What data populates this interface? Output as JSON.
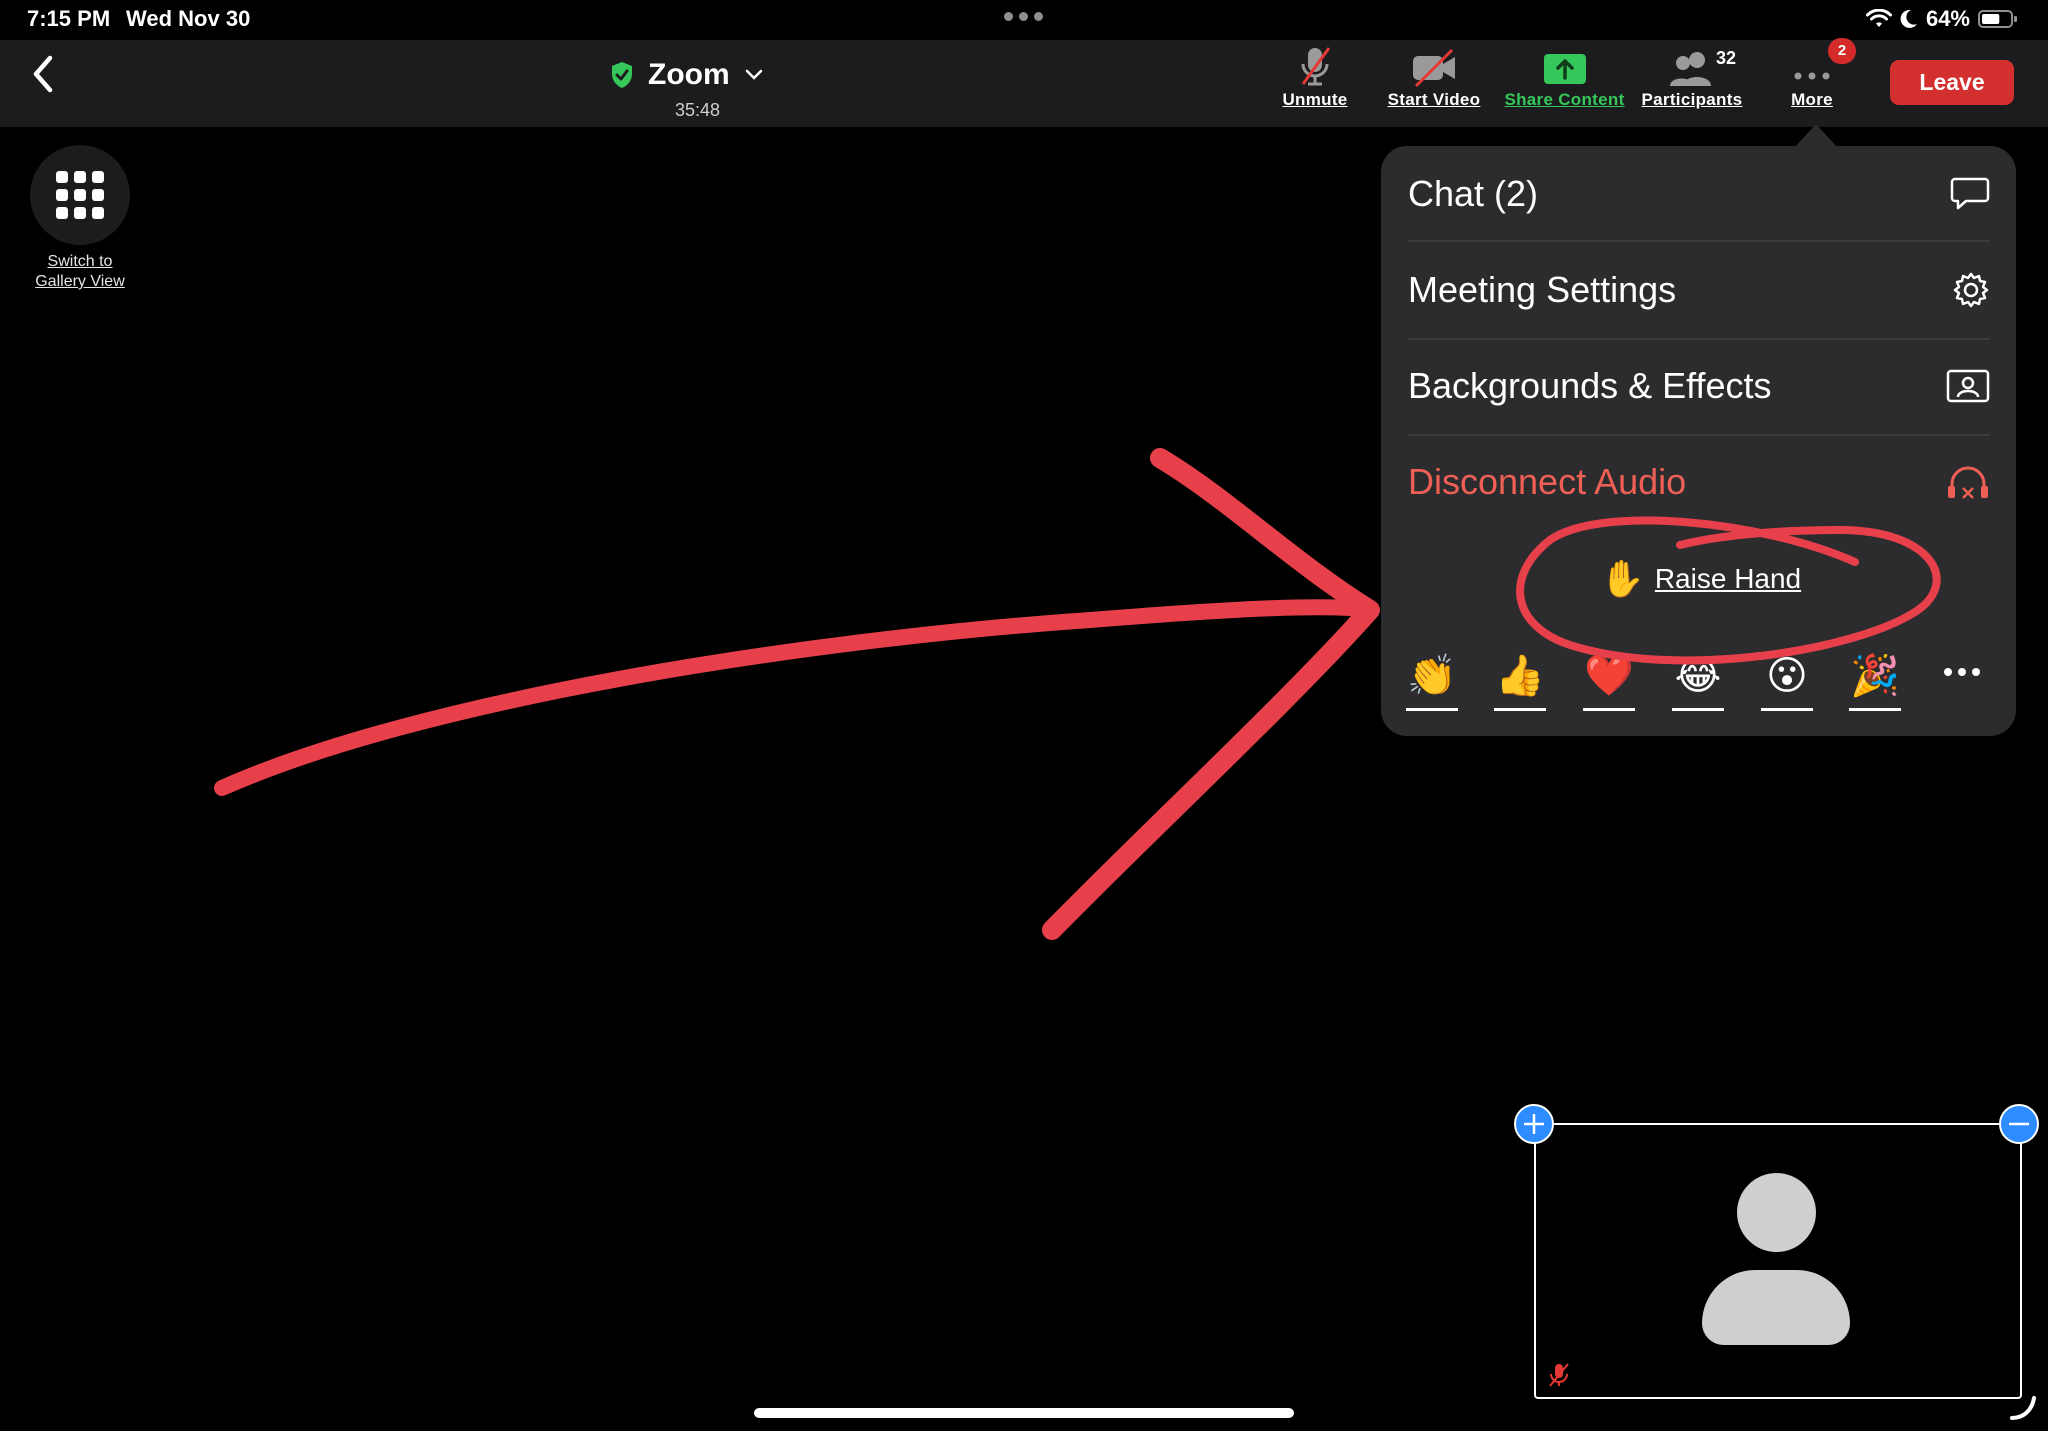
{
  "status_bar": {
    "time": "7:15 PM",
    "date": "Wed Nov 30",
    "battery_percent": "64%",
    "battery_level": 0.64
  },
  "header": {
    "meeting_title": "Zoom",
    "elapsed_time": "35:48"
  },
  "toolbar": {
    "unmute_label": "Unmute",
    "start_video_label": "Start Video",
    "share_content_label": "Share Content",
    "participants_label": "Participants",
    "participants_count": "32",
    "more_label": "More",
    "more_badge": "2",
    "leave_label": "Leave"
  },
  "gallery": {
    "switch_label_line1": "Switch to",
    "switch_label_line2": "Gallery View"
  },
  "more_menu": {
    "items": [
      {
        "label": "Chat (2)",
        "icon": "chat-bubble-icon"
      },
      {
        "label": "Meeting Settings",
        "icon": "gear-icon"
      },
      {
        "label": "Backgrounds & Effects",
        "icon": "portrait-icon"
      },
      {
        "label": "Disconnect Audio",
        "icon": "headphones-disconnect-icon"
      }
    ],
    "raise_hand": {
      "emoji": "✋",
      "label": "Raise Hand"
    },
    "reactions": [
      "👏",
      "👍",
      "❤️",
      "😂",
      "😮",
      "🎉"
    ]
  },
  "colors": {
    "share_green": "#35c759",
    "leave_red": "#d32f2f",
    "danger_text": "#ee5f55",
    "annotation_red": "#e8404a",
    "accent_blue": "#2d8cff"
  }
}
